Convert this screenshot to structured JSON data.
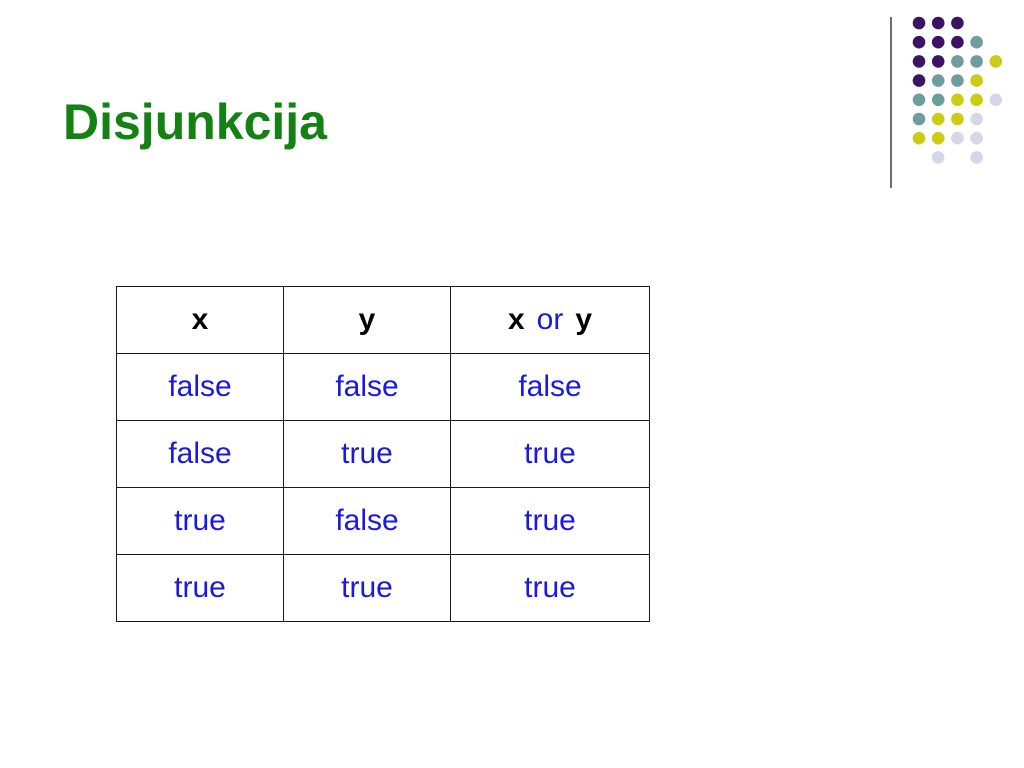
{
  "slide": {
    "title": "Disjunkcija"
  },
  "table": {
    "headers": {
      "col1": "x",
      "col2": "y",
      "col3_left": "x",
      "col3_op": "or",
      "col3_right": "y"
    },
    "rows": [
      [
        "false",
        "false",
        "false"
      ],
      [
        "false",
        "true",
        "true"
      ],
      [
        "true",
        "false",
        "true"
      ],
      [
        "true",
        "true",
        "true"
      ]
    ]
  },
  "decoration": {
    "dot_colors": {
      "purple": "#3b1466",
      "teal": "#6f9c9c",
      "yellow": "#cccc14",
      "lavender": "#d6d6e8"
    },
    "dot_grid": [
      [
        "purple",
        "purple",
        "purple",
        null,
        null
      ],
      [
        "purple",
        "purple",
        "purple",
        "teal",
        null
      ],
      [
        "purple",
        "purple",
        "teal",
        "teal",
        "yellow"
      ],
      [
        "purple",
        "teal",
        "teal",
        "yellow",
        null
      ],
      [
        "teal",
        "teal",
        "yellow",
        "yellow",
        "lavender"
      ],
      [
        "teal",
        "yellow",
        "yellow",
        "lavender",
        null
      ],
      [
        "yellow",
        "yellow",
        "lavender",
        "lavender",
        null
      ],
      [
        null,
        "lavender",
        null,
        "lavender",
        null
      ]
    ]
  }
}
